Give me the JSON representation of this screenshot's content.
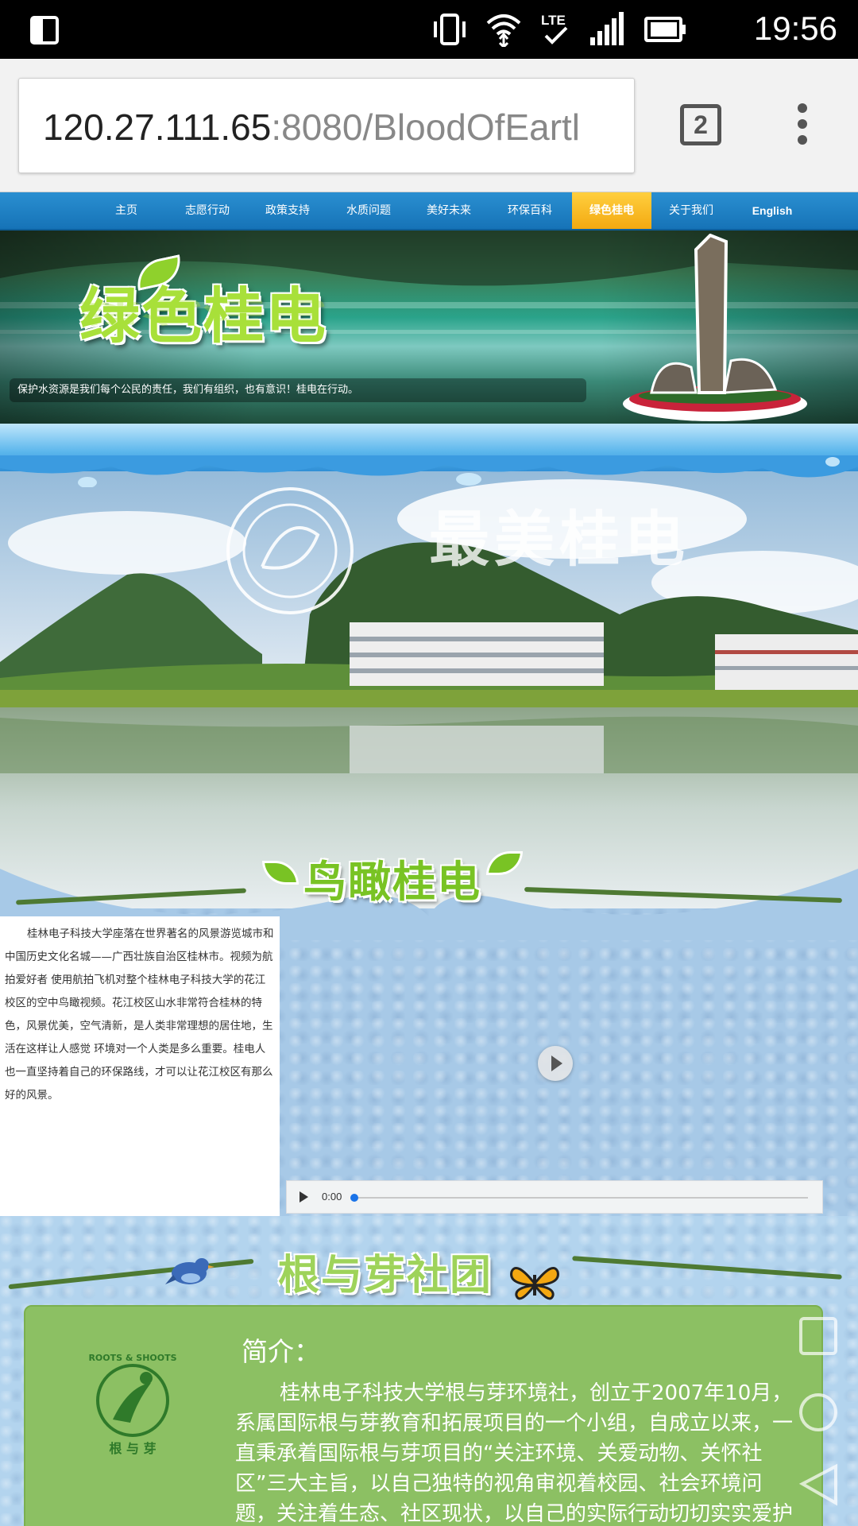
{
  "status_bar": {
    "time": "19:56",
    "network": "LTE",
    "icons": [
      "screen-rotation-icon",
      "vibrate-icon",
      "wifi-icon",
      "lte-icon",
      "signal-icon",
      "battery-icon"
    ]
  },
  "browser": {
    "url_host": "120.27.111.65",
    "url_rest": ":8080/BloodOfEartl",
    "tab_count": "2"
  },
  "nav": {
    "items": [
      {
        "label": "主页"
      },
      {
        "label": "志愿行动"
      },
      {
        "label": "政策支持"
      },
      {
        "label": "水质问题"
      },
      {
        "label": "美好未来"
      },
      {
        "label": "环保百科"
      },
      {
        "label": "绿色桂电",
        "active": true
      },
      {
        "label": "关于我们"
      },
      {
        "label": "English"
      }
    ],
    "colors": {
      "bar": "#1f80c6",
      "active": "#f8bd2a"
    }
  },
  "banner": {
    "title": "绿色桂电",
    "slogan": "保护水资源是我们每个公民的责任，我们有组织，也有意识！桂电在行动。"
  },
  "aerial": {
    "photo_caption": "最美桂电",
    "heading": "鸟瞰桂电",
    "description": "桂林电子科技大学座落在世界著名的风景游览城市和中国历史文化名城——广西壮族自治区桂林市。视频为航拍爱好者 使用航拍飞机对整个桂林电子科技大学的花江校区的空中鸟瞰视频。花江校区山水非常符合桂林的特色，风景优美，空气清新，是人类非常理想的居住地，生活在这样让人感觉 环境对一个人类是多么重要。桂电人也一直坚持着自己的环保路线，才可以让花江校区有那么好的风景。",
    "audio_time": "0:00"
  },
  "roots": {
    "heading": "根与芽社团",
    "intro_title": "简介：",
    "intro_body": "桂林电子科技大学根与芽环境社，创立于2007年10月，系属国际根与芽教育和拓展项目的一个小组，自成立以来，一直秉承着国际根与芽项目的“关注环境、关爱动物、关怀社区”三大主旨，以自己独特的视角审视着校园、社会环境问题，关注着生态、社区现状，以自己的实际行动切切实实爱护着地球这一个共有的家园",
    "logo_text": "ROOTS & SHOOTS THE JANE GOODALL INSTITUTE 根与芽",
    "card_color": "#8cc063"
  }
}
